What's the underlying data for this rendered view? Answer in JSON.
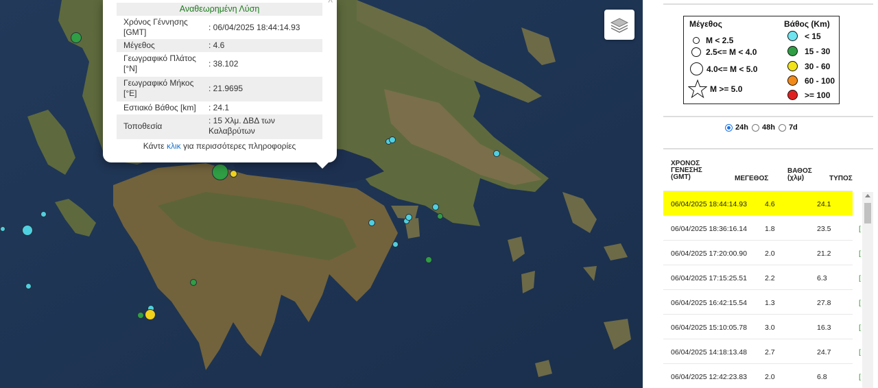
{
  "popup": {
    "title": "Αναθεωρημένη Λύση",
    "rows": [
      {
        "label": "Χρόνος Γέννησης [GMT]",
        "value": ": 06/04/2025 18:44:14.93"
      },
      {
        "label": "Μέγεθος",
        "value": ": 4.6"
      },
      {
        "label": "Γεωγραφικό Πλάτος [°N]",
        "value": ": 38.102"
      },
      {
        "label": "Γεωγραφικό Μήκος [°E]",
        "value": ": 21.9695"
      },
      {
        "label": "Εστιακό Βάθος [km]",
        "value": ": 24.1"
      },
      {
        "label": "Τοποθεσία",
        "value": ": 15 Χλμ. ΔΒΔ των Καλαβρύτων"
      }
    ],
    "more_prefix": "Κάντε",
    "more_link": "κλικ",
    "more_suffix": "για περισσότερες πληροφορίες"
  },
  "legend": {
    "magnitude_title": "Μέγεθος",
    "magnitude_items": [
      "M < 2.5",
      "2.5<= M < 4.0",
      "4.0<= M < 5.0",
      "M >= 5.0"
    ],
    "depth_title": "Βάθος (Km)",
    "depth_items": [
      {
        "label": "< 15",
        "color": "#6fe3f0"
      },
      {
        "label": "15 - 30",
        "color": "#2f9e44"
      },
      {
        "label": "30 - 60",
        "color": "#f2e21a"
      },
      {
        "label": "60 - 100",
        "color": "#f28a1a"
      },
      {
        "label": ">= 100",
        "color": "#e02020"
      }
    ]
  },
  "timeframe": {
    "options": [
      "24h",
      "48h",
      "7d"
    ],
    "selected": "24h"
  },
  "table": {
    "headers": {
      "time": "ΧΡΟΝΟΣ ΓΕΝΕΣΗΣ (GMT)",
      "magnitude": "ΜΕΓΕΘΟΣ",
      "depth": "ΒΑΘΟΣ (χλμ)",
      "type": "ΤΥΠΟΣ"
    },
    "rows": [
      {
        "time": "06/04/2025 18:44:14.93",
        "magnitude": "4.6",
        "depth": "24.1",
        "type": "[",
        "selected": true
      },
      {
        "time": "06/04/2025 18:36:16.14",
        "magnitude": "1.8",
        "depth": "23.5",
        "type": "["
      },
      {
        "time": "06/04/2025 17:20:00.90",
        "magnitude": "2.0",
        "depth": "21.2",
        "type": "["
      },
      {
        "time": "06/04/2025 17:15:25.51",
        "magnitude": "2.2",
        "depth": "6.3",
        "type": "["
      },
      {
        "time": "06/04/2025 16:42:15.54",
        "magnitude": "1.3",
        "depth": "27.8",
        "type": "["
      },
      {
        "time": "06/04/2025 15:10:05.78",
        "magnitude": "3.0",
        "depth": "16.3",
        "type": "["
      },
      {
        "time": "06/04/2025 14:18:13.48",
        "magnitude": "2.7",
        "depth": "24.7",
        "type": "["
      },
      {
        "time": "06/04/2025 12:42:23.83",
        "magnitude": "2.0",
        "depth": "6.8",
        "type": "["
      }
    ]
  },
  "map": {
    "layers_icon": "layers-icon",
    "quake_colors": {
      "shallow": "#4fd0e0",
      "mid": "#2f9e44",
      "deep": "#f2d21a"
    }
  }
}
